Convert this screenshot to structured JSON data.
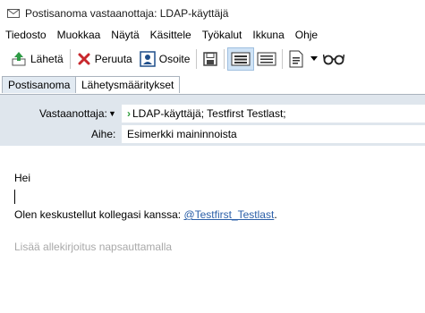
{
  "window": {
    "title": "Postisanoma vastaanottaja: LDAP-käyttäjä"
  },
  "menu": [
    "Tiedosto",
    "Muokkaa",
    "Näytä",
    "Käsittele",
    "Työkalut",
    "Ikkuna",
    "Ohje"
  ],
  "toolbar": {
    "send_label": "Lähetä",
    "cancel_label": "Peruuta",
    "address_label": "Osoite"
  },
  "tabs": {
    "message": "Postisanoma",
    "send_settings": "Lähetysmääritykset"
  },
  "header": {
    "to_label": "Vastaanottaja:",
    "to_value": "LDAP-käyttäjä;  Testfirst Testlast;",
    "subject_label": "Aihe:",
    "subject_value": "Esimerkki maininnoista"
  },
  "body": {
    "greeting": "Hei",
    "mention_prefix": "Olen keskustellut kollegasi kanssa: ",
    "mention": "@Testfirst_Testlast",
    "mention_suffix": ".",
    "signature_placeholder": "Lisää allekirjoitus napsauttamalla"
  },
  "colors": {
    "header_bg": "#dfe6ed",
    "mention": "#2b5fa8",
    "accent": "#2d9b3a"
  }
}
